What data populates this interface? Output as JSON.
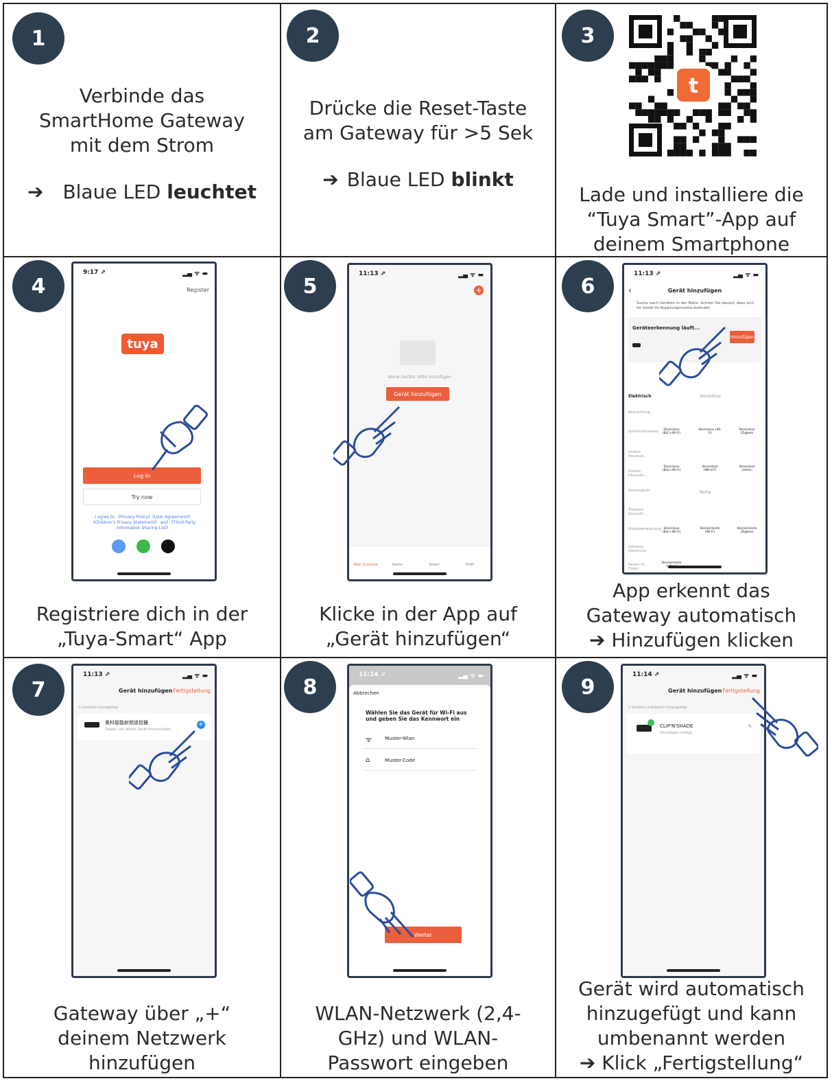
{
  "steps": [
    {
      "num": "1",
      "lines": [
        "Verbinde das",
        "SmartHome Gateway",
        "mit dem Strom"
      ],
      "result_prefix": "➔",
      "result_text": "Blaue LED ",
      "result_bold": "leuchtet"
    },
    {
      "num": "2",
      "lines": [
        "Drücke die Reset-Taste",
        "am Gateway für >5 Sek"
      ],
      "result_prefix": "➔",
      "result_text": "Blaue LED ",
      "result_bold": "blinkt"
    },
    {
      "num": "3",
      "lines": [
        "Lade und installiere die",
        "“Tuya Smart”-App auf",
        "deinem Smartphone"
      ]
    },
    {
      "num": "4",
      "lines": [
        "Registriere dich in der",
        "„Tuya-Smart“ App"
      ]
    },
    {
      "num": "5",
      "lines": [
        "Klicke in der App auf",
        "„Gerät hinzufügen“"
      ]
    },
    {
      "num": "6",
      "lines": [
        "App erkennt das",
        "Gateway automatisch",
        "➔  Hinzufügen klicken"
      ]
    },
    {
      "num": "7",
      "lines": [
        "Gateway über „+“",
        "deinem Netzwerk",
        "hinzufügen"
      ]
    },
    {
      "num": "8",
      "lines": [
        "WLAN-Netzwerk (2,4-",
        "GHz) und WLAN-",
        "Passwort eingeben"
      ]
    },
    {
      "num": "9",
      "lines": [
        "Gerät wird automatisch",
        "hinzugefügt und kann",
        "umbenannt werden",
        "➔  Klick „Fertigstellung“"
      ]
    }
  ],
  "qr": {
    "logo_letter": "t"
  },
  "screen4": {
    "time": "9:17 ⇗",
    "register": "Register",
    "logo": "tuya",
    "login": "Log In",
    "try": "Try now",
    "agree": "I agree to 《Privacy Policy》《User Agreement》《Children's Privacy Statement》 and 《Third Party Information Sharing List》"
  },
  "screen5": {
    "time": "11:13 ⇗",
    "empty": "Keine Geräte; bitte hinzufügen",
    "add": "Gerät hinzufügen",
    "tabs": [
      "Mein Zuhause",
      "Szene",
      "Smart",
      "Profil"
    ]
  },
  "screen6": {
    "time": "11:13 ⇗",
    "title": "Gerät hinzufügen",
    "hint": "Suche nach Geräten in der Nähe. Achten Sie darauf, dass sich Ihr Gerät im Kopplungsmodus befindet.",
    "detect": "Geräteerkennung läuft...",
    "add_btn": "Hinzufügen",
    "categories": [
      "Elektrisch",
      "Beleuchtung",
      "Sicherheitssensor",
      "Großes Haushalt...",
      "Kleines Haushalt...",
      "Küchengerät",
      "Tragbare Gesundh...",
      "Videoüberwachung",
      "Gateway-Steuerung",
      "Reisen im Freien"
    ],
    "group1": "Steckdose",
    "group2": "Reihe",
    "items1": [
      "Steckdose (BLE+Wi-Fi)",
      "Steckdose (Wi-Fi)",
      "Steckdose (Zigbee)"
    ],
    "items2": [
      "Steckdose (BLE+Wi-Fi)",
      "Steckdose (NB-IoT)",
      "Steckdose (other)"
    ],
    "items3": [
      "Steckdose (BLE+Wi-Fi)",
      "Steckerleiste (Wi-Fi)",
      "Steckerleiste (Zigbee)"
    ],
    "items4": [
      "Steckerleiste (other)"
    ]
  },
  "screen7": {
    "time": "11:13 ⇗",
    "title": "Gerät hinzufügen",
    "done": "Fertigstellung",
    "count": "1 Gerät(e) hinzugefügt",
    "device": "奥科智能射频遥控器",
    "device_sub": "Tippen, um dieses Gerät hinzuzufügen"
  },
  "screen8": {
    "time": "11:14 ⇗",
    "cancel": "Abbrechen",
    "heading": "Wählen Sie das Gerät für Wi-Fi aus und geben Sie das Kennwort ein",
    "ssid": "Muster-Wlan",
    "password": "Muster-Code",
    "next": "Weiter"
  },
  "screen9": {
    "time": "11:14 ⇗",
    "title": "Gerät hinzufügen",
    "done": "Fertigstellung",
    "count": "1 Gerät(e) erfolgreich hinzugefügt",
    "device": "CLIP'N'SHADE",
    "device_sub": "Hinzufügen erfolgt"
  },
  "colors": {
    "accent": "#ec5e3c",
    "badge": "#2d3e4f"
  }
}
